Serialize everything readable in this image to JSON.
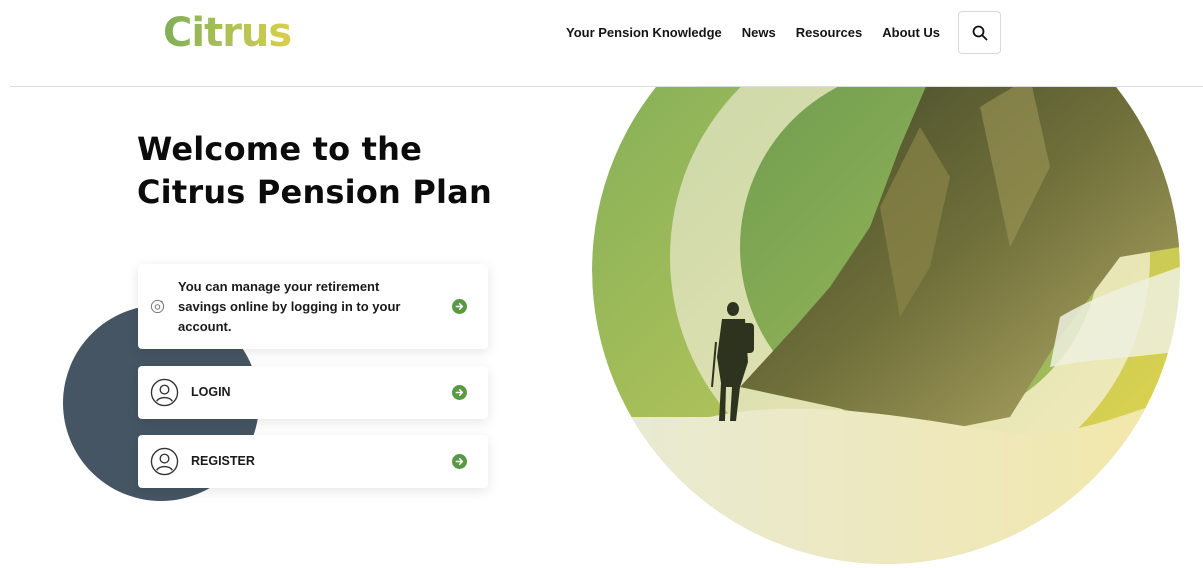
{
  "brand": {
    "logo_text": "Citrus"
  },
  "nav": {
    "items": [
      "Your Pension Knowledge",
      "News",
      "Resources",
      "About Us"
    ],
    "search_icon": "search-icon"
  },
  "hero": {
    "title_line1": "Welcome to the",
    "title_line2": "Citrus Pension Plan"
  },
  "cards": {
    "info": {
      "text": "You can manage your retirement savings online by logging in to your account.",
      "icon": "at-icon"
    },
    "login": {
      "label": "LOGIN",
      "icon": "user-circle-icon"
    },
    "register": {
      "label": "REGISTER",
      "icon": "user-circle-icon"
    }
  },
  "colors": {
    "accent_green": "#5a9944",
    "dark_circle": "#455563",
    "gradient_start": "#7fae57",
    "gradient_end": "#e8d24a"
  }
}
